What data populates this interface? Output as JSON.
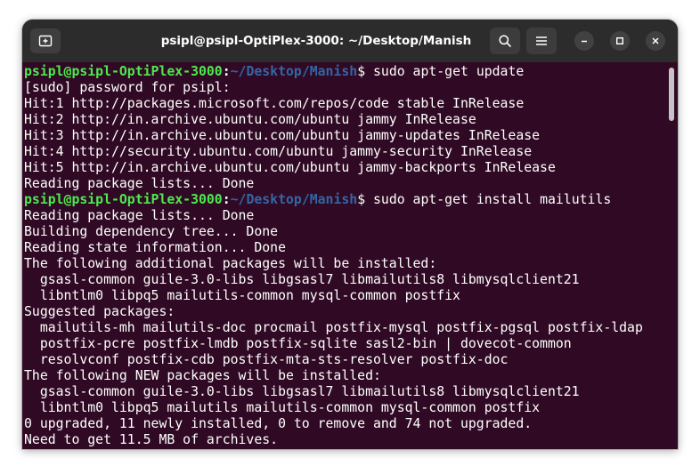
{
  "window": {
    "title": "psipl@psipl-OptiPlex-3000: ~/Desktop/Manish"
  },
  "titlebar_icons": {
    "new_tab": "new-tab-icon",
    "search": "search-icon",
    "menu": "hamburger-menu-icon",
    "minimize": "minimize-icon",
    "maximize": "maximize-icon",
    "close": "close-icon"
  },
  "colors": {
    "terminal_background": "#300a24",
    "titlebar_background": "#2c2c2c",
    "prompt_user": "#4ee94e",
    "prompt_path": "#3465a4",
    "text": "#ffffff"
  },
  "terminal": {
    "lines": [
      {
        "prompt": {
          "user": "psipl@psipl-OptiPlex-3000",
          "colon": ":",
          "path": "~/Desktop/Manish"
        },
        "text": "$ sudo apt-get update"
      },
      {
        "text": "[sudo] password for psipl:"
      },
      {
        "text": "Hit:1 http://packages.microsoft.com/repos/code stable InRelease"
      },
      {
        "text": "Hit:2 http://in.archive.ubuntu.com/ubuntu jammy InRelease"
      },
      {
        "text": "Hit:3 http://in.archive.ubuntu.com/ubuntu jammy-updates InRelease"
      },
      {
        "text": "Hit:4 http://security.ubuntu.com/ubuntu jammy-security InRelease"
      },
      {
        "text": "Hit:5 http://in.archive.ubuntu.com/ubuntu jammy-backports InRelease"
      },
      {
        "text": "Reading package lists... Done"
      },
      {
        "prompt": {
          "user": "psipl@psipl-OptiPlex-3000",
          "colon": ":",
          "path": "~/Desktop/Manish"
        },
        "text": "$ sudo apt-get install mailutils"
      },
      {
        "text": "Reading package lists... Done"
      },
      {
        "text": "Building dependency tree... Done"
      },
      {
        "text": "Reading state information... Done"
      },
      {
        "text": "The following additional packages will be installed:"
      },
      {
        "text": "  gsasl-common guile-3.0-libs libgsasl7 libmailutils8 libmysqlclient21"
      },
      {
        "text": "  libntlm0 libpq5 mailutils-common mysql-common postfix"
      },
      {
        "text": "Suggested packages:"
      },
      {
        "text": "  mailutils-mh mailutils-doc procmail postfix-mysql postfix-pgsql postfix-ldap"
      },
      {
        "text": "  postfix-pcre postfix-lmdb postfix-sqlite sasl2-bin | dovecot-common"
      },
      {
        "text": "  resolvconf postfix-cdb postfix-mta-sts-resolver postfix-doc"
      },
      {
        "text": "The following NEW packages will be installed:"
      },
      {
        "text": "  gsasl-common guile-3.0-libs libgsasl7 libmailutils8 libmysqlclient21"
      },
      {
        "text": "  libntlm0 libpq5 mailutils mailutils-common mysql-common postfix"
      },
      {
        "text": "0 upgraded, 11 newly installed, 0 to remove and 74 not upgraded."
      },
      {
        "text": "Need to get 11.5 MB of archives."
      }
    ]
  }
}
